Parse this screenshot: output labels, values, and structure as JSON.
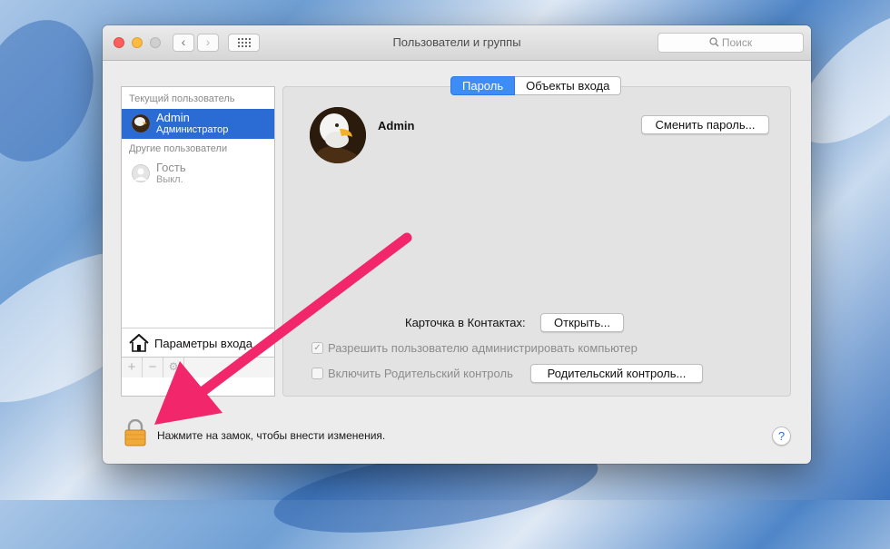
{
  "window": {
    "title": "Пользователи и группы"
  },
  "toolbar": {
    "back_glyph": "‹",
    "forward_glyph": "›",
    "search_placeholder": "Поиск",
    "search_icon": "magnifier-icon",
    "grid_icon": "show-all-grid-icon"
  },
  "sidebar": {
    "current_header": "Текущий пользователь",
    "current_user": {
      "name": "Admin",
      "role": "Администратор"
    },
    "other_header": "Другие пользователи",
    "other_users": [
      {
        "name": "Гость",
        "status": "Выкл."
      }
    ],
    "login_options_label": "Параметры входа",
    "footer": {
      "add": "+",
      "remove": "−",
      "gear": "⚙"
    }
  },
  "tabs": [
    {
      "label": "Пароль",
      "active": true
    },
    {
      "label": "Объекты входа",
      "active": false
    }
  ],
  "main": {
    "user_name": "Admin",
    "change_password_button": "Сменить пароль...",
    "contacts_label": "Карточка в Контактах:",
    "open_button": "Открыть...",
    "allow_admin_label": "Разрешить пользователю администрировать компьютер",
    "allow_admin_checked": true,
    "parental_label": "Включить Родительский контроль",
    "parental_checked": false,
    "parental_button": "Родительский контроль..."
  },
  "footer": {
    "lock_text": "Нажмите на замок, чтобы внести изменения.",
    "help": "?"
  },
  "colors": {
    "selection": "#2a6cd3",
    "tab_active": "#3e8cf6",
    "annotation_arrow": "#f2266a",
    "lock": "#f0a93a"
  }
}
